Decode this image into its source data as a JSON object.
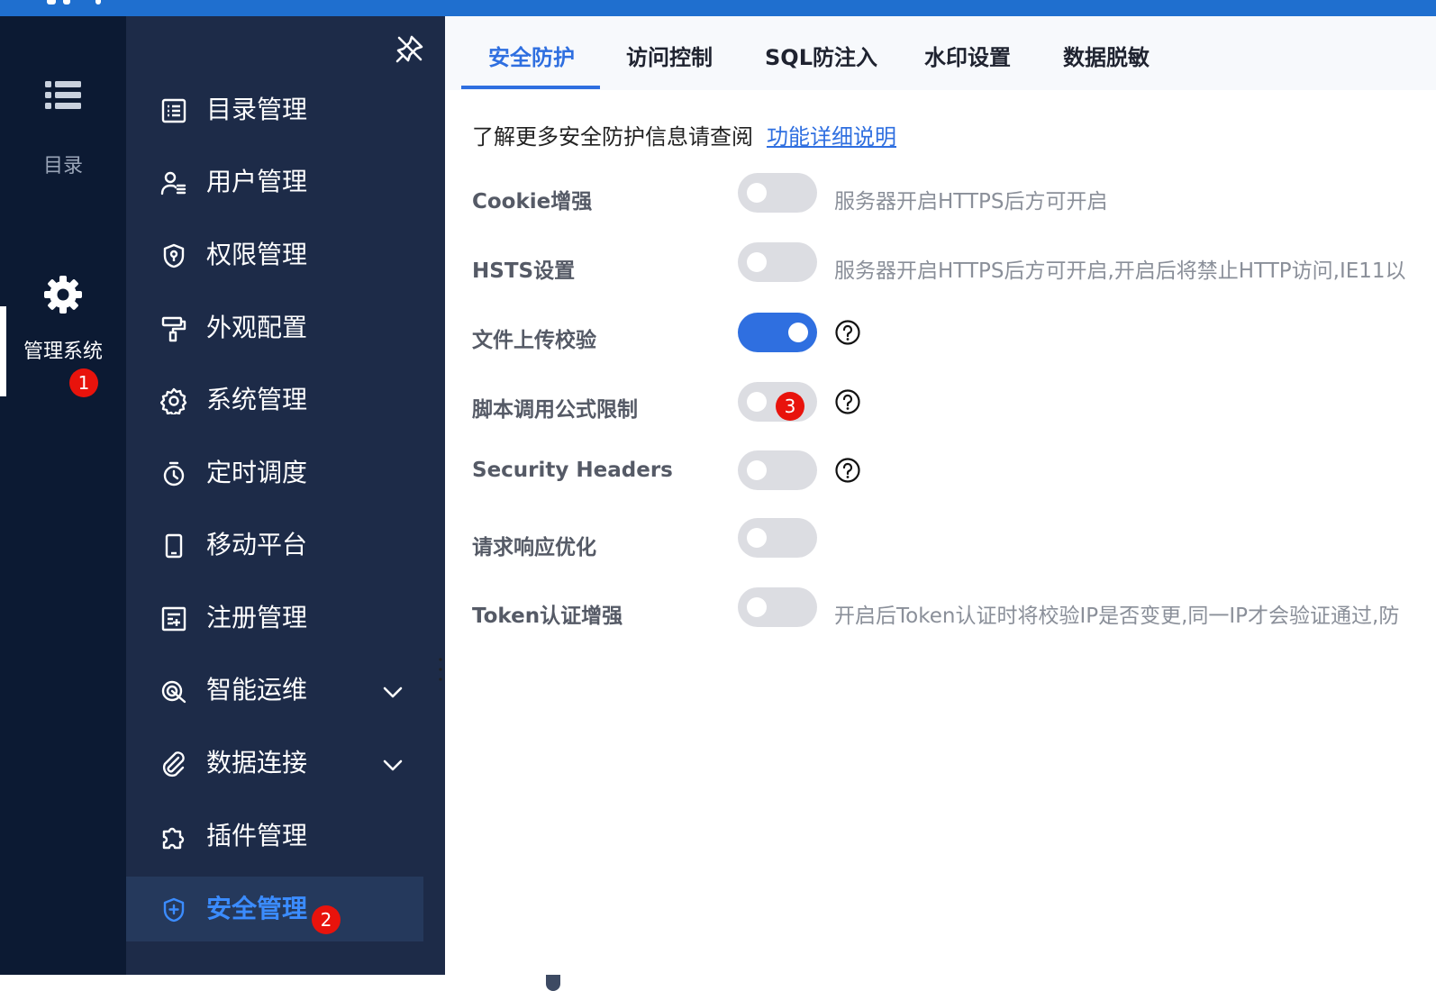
{
  "colors": {
    "accent": "#2f6fe0",
    "rail_bg": "#0c1a33",
    "menu_bg": "#1d2b48",
    "badge": "#e8130c"
  },
  "rail": {
    "items": [
      {
        "label": "目录",
        "icon": "list-icon",
        "active": false
      },
      {
        "label": "管理系统",
        "icon": "gear-icon",
        "active": true
      }
    ]
  },
  "menu": {
    "pin_icon": "pin-off-icon",
    "items": [
      {
        "label": "目录管理",
        "icon": "list-icon"
      },
      {
        "label": "用户管理",
        "icon": "user-icon"
      },
      {
        "label": "权限管理",
        "icon": "shield-icon"
      },
      {
        "label": "外观配置",
        "icon": "paint-roller-icon"
      },
      {
        "label": "系统管理",
        "icon": "gear-icon"
      },
      {
        "label": "定时调度",
        "icon": "stopwatch-icon"
      },
      {
        "label": "移动平台",
        "icon": "mobile-icon"
      },
      {
        "label": "注册管理",
        "icon": "register-icon"
      },
      {
        "label": "智能运维",
        "icon": "radar-icon",
        "expandable": true
      },
      {
        "label": "数据连接",
        "icon": "paperclip-icon",
        "expandable": true
      },
      {
        "label": "插件管理",
        "icon": "puzzle-icon"
      },
      {
        "label": "安全管理",
        "icon": "shield-plus-icon",
        "active": true
      }
    ]
  },
  "tabs": [
    {
      "label": "安全防护",
      "active": true
    },
    {
      "label": "访问控制"
    },
    {
      "label": "SQL防注入"
    },
    {
      "label": "水印设置"
    },
    {
      "label": "数据脱敏"
    }
  ],
  "intro": {
    "text": "了解更多安全防护信息请查阅",
    "link": "功能详细说明"
  },
  "settings": [
    {
      "label": "Cookie增强",
      "enabled": false,
      "desc": "服务器开启HTTPS后方可开启"
    },
    {
      "label": "HSTS设置",
      "enabled": false,
      "desc": "服务器开启HTTPS后方可开启,开启后将禁止HTTP访问,IE11以"
    },
    {
      "label": "文件上传校验",
      "enabled": true,
      "help": true
    },
    {
      "label": "脚本调用公式限制",
      "enabled": false,
      "help": true
    },
    {
      "label": "Security Headers",
      "enabled": false,
      "help": true
    },
    {
      "label": "请求响应优化",
      "enabled": false
    },
    {
      "label": "Token认证增强",
      "enabled": false,
      "desc": "开启后Token认证时将校验IP是否变更,同一IP才会验证通过,防"
    }
  ],
  "badges": [
    "1",
    "2",
    "3"
  ]
}
